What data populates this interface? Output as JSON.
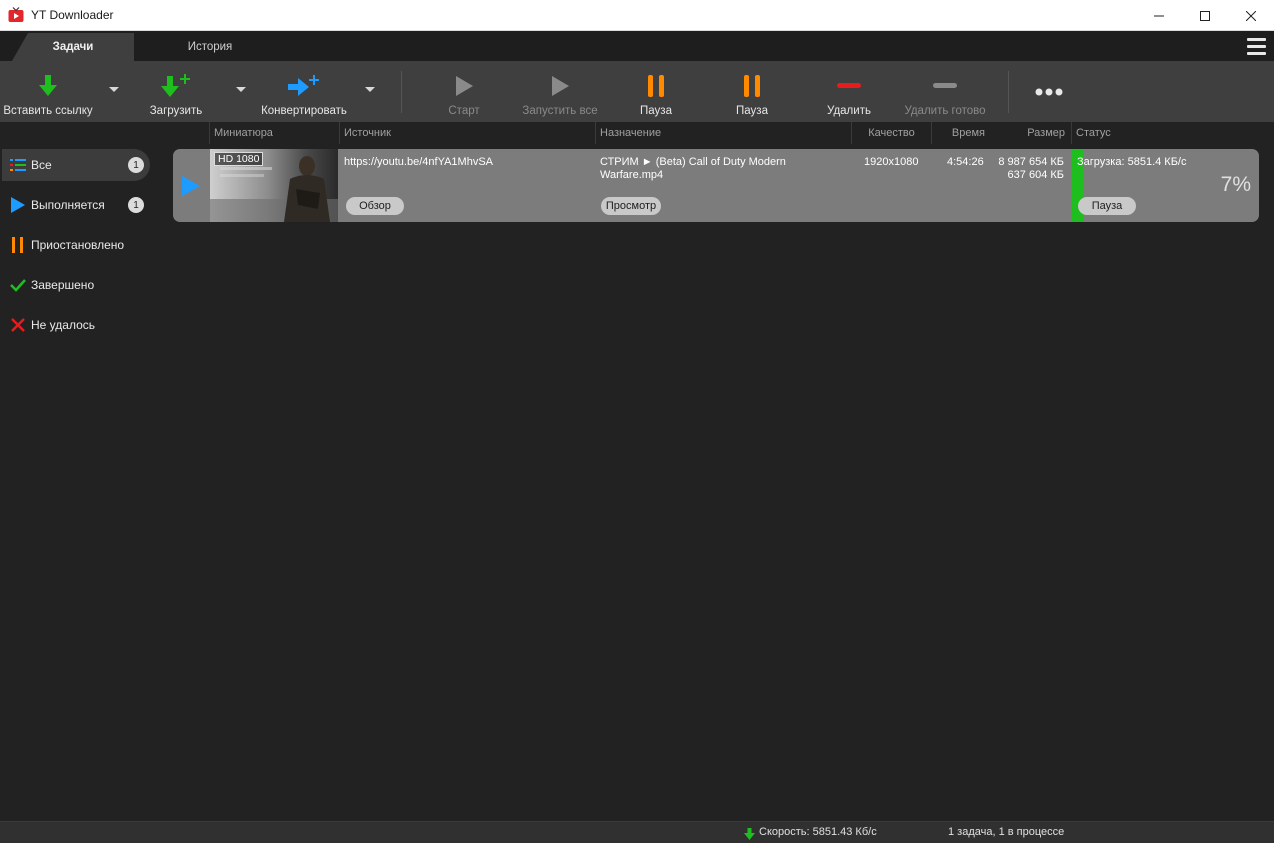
{
  "window": {
    "title": "YT Downloader"
  },
  "tabs": [
    {
      "label": "Задачи"
    },
    {
      "label": "История"
    }
  ],
  "toolbar": {
    "paste_link": "Вставить ссылку",
    "download": "Загрузить",
    "convert": "Конвертировать",
    "start": "Старт",
    "start_all": "Запустить все",
    "pause1": "Пауза",
    "pause2": "Пауза",
    "delete": "Удалить",
    "delete_done": "Удалить готово"
  },
  "columns": [
    "Миниатюра",
    "Источник",
    "Назначение",
    "Качество",
    "Время",
    "Размер",
    "Статус"
  ],
  "sidebar": {
    "items": [
      {
        "label": "Все",
        "count": "1"
      },
      {
        "label": "Выполняется",
        "count": "1"
      },
      {
        "label": "Приостановлено"
      },
      {
        "label": "Завершено"
      },
      {
        "label": "Не удалось"
      }
    ]
  },
  "task": {
    "badge": "HD 1080",
    "source": "https://youtu.be/4nfYA1MhvSA",
    "browse": "Обзор",
    "destination_line1": "СТРИМ ► (Beta) Call of Duty Modern",
    "destination_line2": "Warfare.mp4",
    "preview": "Просмотр",
    "quality": "1920x1080",
    "duration": "4:54:26",
    "size_total": "8 987 654 КБ",
    "size_done": "637 604 КБ",
    "status": "Загрузка: 5851.4 КБ/с",
    "pause": "Пауза",
    "progress": "7%"
  },
  "statusbar": {
    "speed": "Скорость: 5851.43 Кб/с",
    "summary": "1 задача, 1 в процессе"
  },
  "colors": {
    "green": "#1fbe1f",
    "blue": "#1e9bff",
    "orange": "#ff8a00",
    "red": "#e81c1c"
  }
}
